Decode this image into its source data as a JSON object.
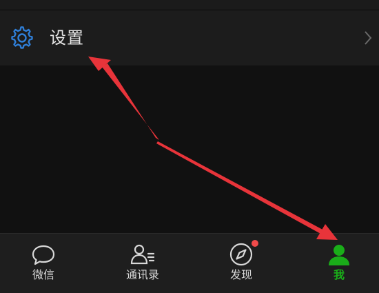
{
  "settings": {
    "label": "设置",
    "icon": "gear-icon"
  },
  "tabbar": {
    "tabs": [
      {
        "label": "微信",
        "icon": "chat-bubble-icon",
        "active": false
      },
      {
        "label": "通讯录",
        "icon": "contacts-icon",
        "active": false
      },
      {
        "label": "发现",
        "icon": "compass-icon",
        "active": false,
        "badge": true
      },
      {
        "label": "我",
        "icon": "person-icon",
        "active": true
      }
    ]
  },
  "colors": {
    "accent": "#1aad19",
    "settings_icon": "#2f7fd8",
    "badge": "#f04a4a",
    "annotation_arrow": "#e8343a"
  }
}
